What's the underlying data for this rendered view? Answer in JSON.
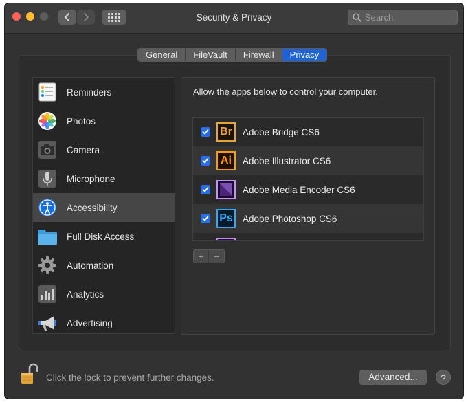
{
  "window": {
    "title": "Security & Privacy"
  },
  "search": {
    "placeholder": "Search"
  },
  "tabs": [
    {
      "label": "General",
      "active": false
    },
    {
      "label": "FileVault",
      "active": false
    },
    {
      "label": "Firewall",
      "active": false
    },
    {
      "label": "Privacy",
      "active": true
    }
  ],
  "sidebar": {
    "items": [
      {
        "label": "Reminders",
        "icon": "reminders-icon",
        "selected": false
      },
      {
        "label": "Photos",
        "icon": "photos-icon",
        "selected": false
      },
      {
        "label": "Camera",
        "icon": "camera-icon",
        "selected": false
      },
      {
        "label": "Microphone",
        "icon": "microphone-icon",
        "selected": false
      },
      {
        "label": "Accessibility",
        "icon": "accessibility-icon",
        "selected": true
      },
      {
        "label": "Full Disk Access",
        "icon": "folder-icon",
        "selected": false
      },
      {
        "label": "Automation",
        "icon": "gear-icon",
        "selected": false
      },
      {
        "label": "Analytics",
        "icon": "analytics-icon",
        "selected": false
      },
      {
        "label": "Advertising",
        "icon": "megaphone-icon",
        "selected": false
      }
    ]
  },
  "content": {
    "description": "Allow the apps below to control your computer.",
    "apps": [
      {
        "name": "Adobe Bridge CS6",
        "icon_text": "Br",
        "checked": true
      },
      {
        "name": "Adobe Illustrator CS6",
        "icon_text": "Ai",
        "checked": true
      },
      {
        "name": "Adobe Media Encoder CS6",
        "icon_text": "",
        "checked": true
      },
      {
        "name": "Adobe Photoshop CS6",
        "icon_text": "Ps",
        "checked": true
      }
    ],
    "add_label": "+",
    "remove_label": "−"
  },
  "footer": {
    "lock_text": "Click the lock to prevent further changes.",
    "advanced_label": "Advanced...",
    "help_label": "?"
  },
  "colors": {
    "accent": "#1e64d6",
    "checkbox": "#2a6ee6",
    "window_bg": "#323232"
  }
}
